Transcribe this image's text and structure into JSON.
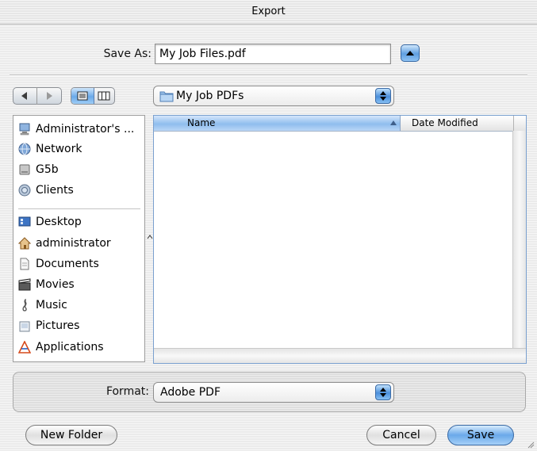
{
  "window": {
    "title": "Export"
  },
  "save_as": {
    "label": "Save As:",
    "value": "My Job Files.pdf"
  },
  "toolbar": {
    "location_popup": {
      "value": "My Job PDFs"
    }
  },
  "sidebar": {
    "devices": [
      {
        "label": "Administrator's ...",
        "icon": "computer-icon"
      },
      {
        "label": "Network",
        "icon": "network-globe-icon"
      },
      {
        "label": "G5b",
        "icon": "hard-drive-icon"
      },
      {
        "label": "Clients",
        "icon": "server-volume-icon"
      }
    ],
    "places": [
      {
        "label": "Desktop",
        "icon": "desktop-icon"
      },
      {
        "label": "administrator",
        "icon": "home-icon"
      },
      {
        "label": "Documents",
        "icon": "documents-icon"
      },
      {
        "label": "Movies",
        "icon": "movies-icon"
      },
      {
        "label": "Music",
        "icon": "music-icon"
      },
      {
        "label": "Pictures",
        "icon": "pictures-icon"
      },
      {
        "label": "Applications",
        "icon": "applications-icon"
      }
    ]
  },
  "file_list": {
    "columns": [
      {
        "label": "Name",
        "sorted": "ascending"
      },
      {
        "label": "Date Modified"
      }
    ],
    "rows": []
  },
  "format": {
    "label": "Format:",
    "value": "Adobe PDF"
  },
  "buttons": {
    "new_folder": "New Folder",
    "cancel": "Cancel",
    "save": "Save"
  },
  "colors": {
    "accent": "#5f9fe1",
    "selection_header": "#8fbdee"
  }
}
